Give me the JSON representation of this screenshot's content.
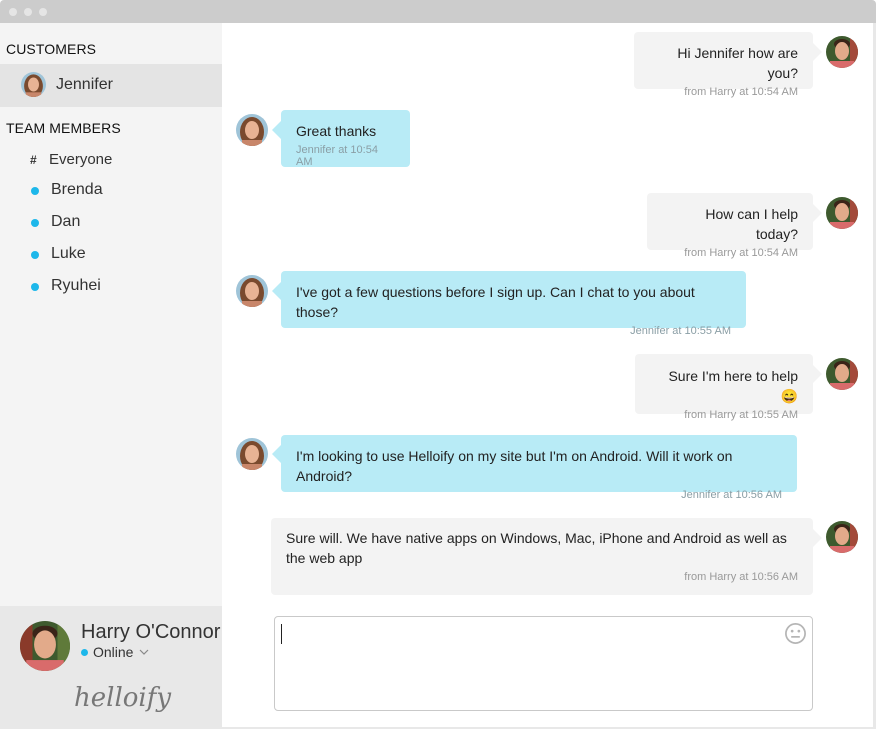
{
  "window": {
    "controls": [
      "close",
      "minimize",
      "maximize"
    ]
  },
  "sidebar": {
    "customers_heading": "CUSTOMERS",
    "customers": [
      {
        "name": "Jennifer",
        "selected": true,
        "avatar": "jennifer-avatar"
      }
    ],
    "team_heading": "TEAM MEMBERS",
    "team": [
      {
        "name": "Everyone",
        "icon": "hash-icon"
      },
      {
        "name": "Brenda",
        "icon": "online-dot"
      },
      {
        "name": "Dan",
        "icon": "online-dot"
      },
      {
        "name": "Luke",
        "icon": "online-dot"
      },
      {
        "name": "Ryuhei",
        "icon": "online-dot"
      }
    ],
    "profile": {
      "name": "Harry O'Connor",
      "status": "Online",
      "logo": "helloify"
    }
  },
  "colors": {
    "accent": "#1db7ea",
    "incoming_bubble": "#b8ebf6",
    "outgoing_bubble": "#f3f3f3",
    "sidebar_bg": "#f4f4f4",
    "selected_row": "#e4e4e4"
  },
  "messages": [
    {
      "direction": "out",
      "text": "Hi Jennifer how are you?",
      "meta": "from Harry at 10:54 AM"
    },
    {
      "direction": "in",
      "text": "Great thanks",
      "meta": "Jennifer at 10:54 AM"
    },
    {
      "direction": "out",
      "text": "How can I help today?",
      "meta": "from Harry at 10:54 AM"
    },
    {
      "direction": "in",
      "text": "I've got a few questions before I sign up. Can I chat to you about those?",
      "meta": "Jennifer at 10:55 AM"
    },
    {
      "direction": "out",
      "text": "Sure I'm here to help",
      "emoji": "😄",
      "meta": "from Harry at 10:55 AM"
    },
    {
      "direction": "in",
      "text": "I'm looking to use Helloify on my site but I'm on Android. Will it work on Android?",
      "meta": "Jennifer at 10:56 AM"
    },
    {
      "direction": "out",
      "text": "Sure will. We have native apps on Windows, Mac, iPhone and Android as well as the web app",
      "meta": "from Harry at 10:56 AM"
    }
  ],
  "composer": {
    "value": "",
    "placeholder": ""
  }
}
